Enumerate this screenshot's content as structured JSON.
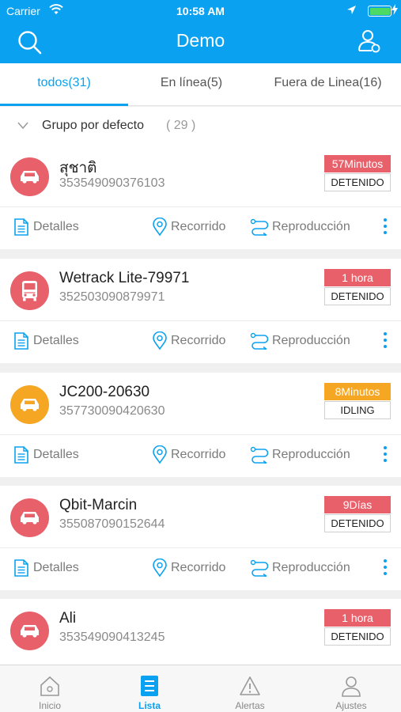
{
  "status_bar": {
    "carrier": "Carrier",
    "time": "10:58 AM"
  },
  "header": {
    "title": "Demo"
  },
  "tabs": [
    {
      "label": "todos(31)",
      "active": true
    },
    {
      "label": "En línea(5)",
      "active": false
    },
    {
      "label": "Fuera de Linea(16)",
      "active": false
    }
  ],
  "group": {
    "label": "Grupo por defecto",
    "count": "( 29 )"
  },
  "actions": {
    "details": "Detalles",
    "route": "Recorrido",
    "playback": "Reproducción"
  },
  "devices": [
    {
      "name": "สุชาติ",
      "imei": "353549090376103",
      "time": "57Minutos",
      "state": "DETENIDO",
      "color": "#e8606a",
      "icon": "car-icon"
    },
    {
      "name": "Wetrack Lite-79971",
      "imei": "352503090879971",
      "time": "1 hora",
      "state": "DETENIDO",
      "color": "#e8606a",
      "icon": "bus-icon"
    },
    {
      "name": "JC200-20630",
      "imei": "357730090420630",
      "time": "8Minutos",
      "state": "IDLING",
      "color": "#f5a623",
      "icon": "car-icon"
    },
    {
      "name": "Qbit-Marcin",
      "imei": "355087090152644",
      "time": "9Días",
      "state": "DETENIDO",
      "color": "#e8606a",
      "icon": "car-icon"
    },
    {
      "name": "Ali",
      "imei": "353549090413245",
      "time": "1 hora",
      "state": "DETENIDO",
      "color": "#e8606a",
      "icon": "car-icon"
    }
  ],
  "bottom_nav": [
    {
      "label": "Inicio",
      "icon": "home-icon",
      "active": false
    },
    {
      "label": "Lista",
      "icon": "list-icon",
      "active": true
    },
    {
      "label": "Alertas",
      "icon": "alert-icon",
      "active": false
    },
    {
      "label": "Ajustes",
      "icon": "user-icon",
      "active": false
    }
  ],
  "colors": {
    "accent": "#0aa2f0",
    "stopped": "#e8606a",
    "idling": "#f5a623",
    "battery": "#4cd964"
  }
}
